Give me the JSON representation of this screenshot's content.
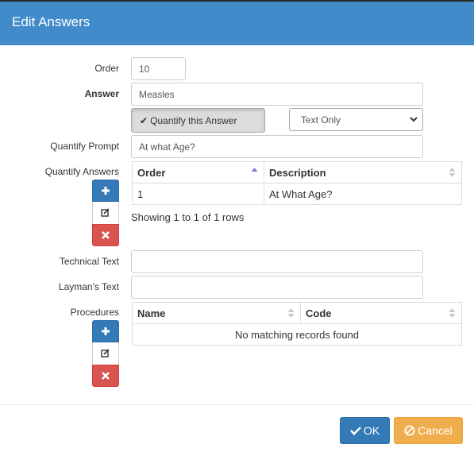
{
  "dialog": {
    "title": "Edit Answers"
  },
  "form": {
    "order": {
      "label": "Order",
      "value": "10"
    },
    "answer": {
      "label": "Answer",
      "value": "Measles"
    },
    "quantify_button": {
      "label": "Quantify this Answer",
      "icon": "check-icon"
    },
    "answer_type": {
      "selected": "Text Only"
    },
    "quantify_prompt": {
      "label": "Quantify Prompt",
      "value": "At what Age?"
    },
    "quantify_answers": {
      "label": "Quantify Answers",
      "columns": [
        "Order",
        "Description"
      ],
      "rows": [
        {
          "order": "1",
          "description": "At What Age?"
        }
      ],
      "pagination": "Showing 1 to 1 of 1 rows"
    },
    "technical_text": {
      "label": "Technical Text",
      "value": ""
    },
    "laymans_text": {
      "label": "Layman's Text",
      "value": ""
    },
    "procedures": {
      "label": "Procedures",
      "columns": [
        "Name",
        "Code"
      ],
      "empty_message": "No matching records found"
    }
  },
  "footer": {
    "ok_label": "OK",
    "cancel_label": "Cancel"
  },
  "colors": {
    "header": "#428bca",
    "primary": "#337ab7",
    "danger": "#d9534f",
    "warning": "#f0ad4e"
  }
}
